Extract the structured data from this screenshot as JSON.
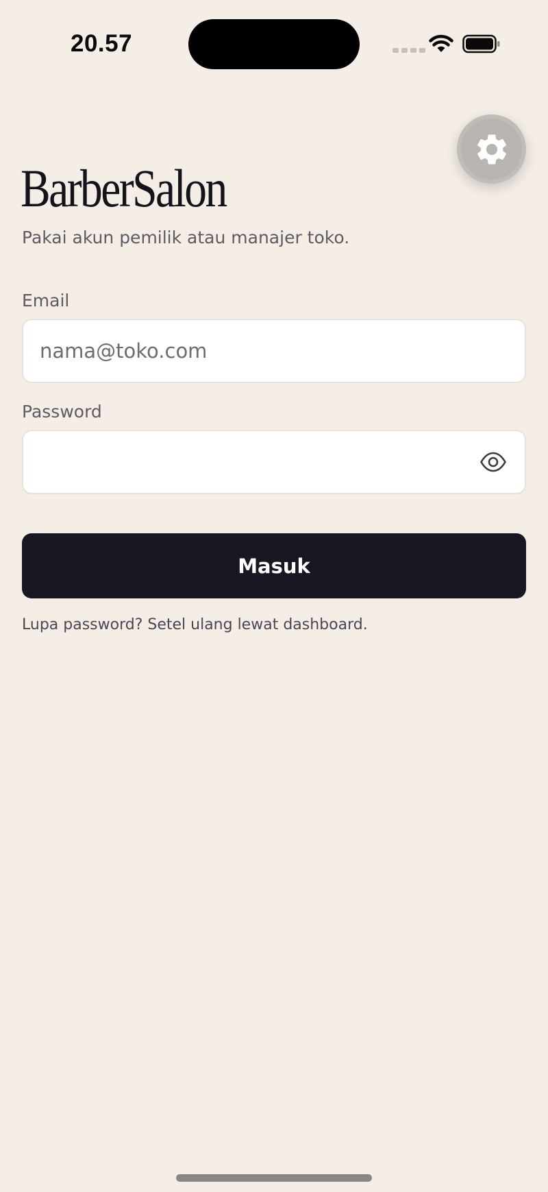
{
  "status_bar": {
    "time": "20.57"
  },
  "brand": {
    "title": "BarberSalon",
    "subtitle": "Pakai akun pemilik atau manajer toko."
  },
  "form": {
    "email_label": "Email",
    "email_placeholder": "nama@toko.com",
    "password_label": "Password",
    "password_value": "",
    "submit_label": "Masuk",
    "forgot_text": "Lupa password? Setel ulang lewat dashboard."
  },
  "icons": {
    "settings": "gear-icon",
    "password_toggle": "eye-icon"
  },
  "colors": {
    "background": "#f4eee7",
    "primary_button": "#181822",
    "settings_button": "#b8b4b0"
  }
}
